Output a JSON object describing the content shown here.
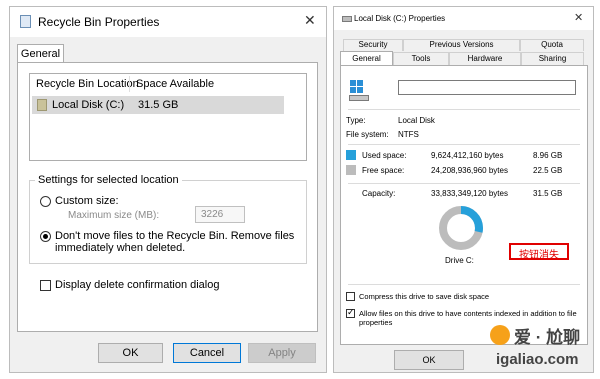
{
  "left": {
    "title": "Recycle Bin Properties",
    "tab": "General",
    "columns": [
      "Recycle Bin Location",
      "Space Available"
    ],
    "row": {
      "location": "Local Disk (C:)",
      "space": "31.5 GB"
    },
    "settings_title": "Settings for selected location",
    "custom_size": "Custom size:",
    "max_size_label": "Maximum size (MB):",
    "max_size_value": "3226",
    "dont_move": "Don't move files to the Recycle Bin. Remove files immediately when deleted.",
    "display_confirm": "Display delete confirmation dialog",
    "buttons": {
      "ok": "OK",
      "cancel": "Cancel",
      "apply": "Apply"
    }
  },
  "right": {
    "title": "Local Disk (C:) Properties",
    "tabs_top": [
      "Security",
      "Previous Versions",
      "Quota"
    ],
    "tabs_bottom": [
      "General",
      "Tools",
      "Hardware",
      "Sharing"
    ],
    "type_label": "Type:",
    "type_value": "Local Disk",
    "fs_label": "File system:",
    "fs_value": "NTFS",
    "used_label": "Used space:",
    "used_bytes": "9,624,412,160 bytes",
    "used_gb": "8.96 GB",
    "free_label": "Free space:",
    "free_bytes": "24,208,936,960 bytes",
    "free_gb": "22.5 GB",
    "cap_label": "Capacity:",
    "cap_bytes": "33,833,349,120 bytes",
    "cap_gb": "31.5 GB",
    "drive_label": "Drive C:",
    "annotation": "按钮消失",
    "compress": "Compress this drive to save disk space",
    "allow_index": "Allow files on this drive to have contents indexed in addition to file properties",
    "ok": "OK",
    "used_fraction": 0.284
  },
  "watermark": {
    "brand": "爱 · 尬聊",
    "site": "igaliao.com"
  },
  "colors": {
    "used": "#26a0da",
    "free": "#bcbcbc",
    "annotation": "#e00000"
  }
}
